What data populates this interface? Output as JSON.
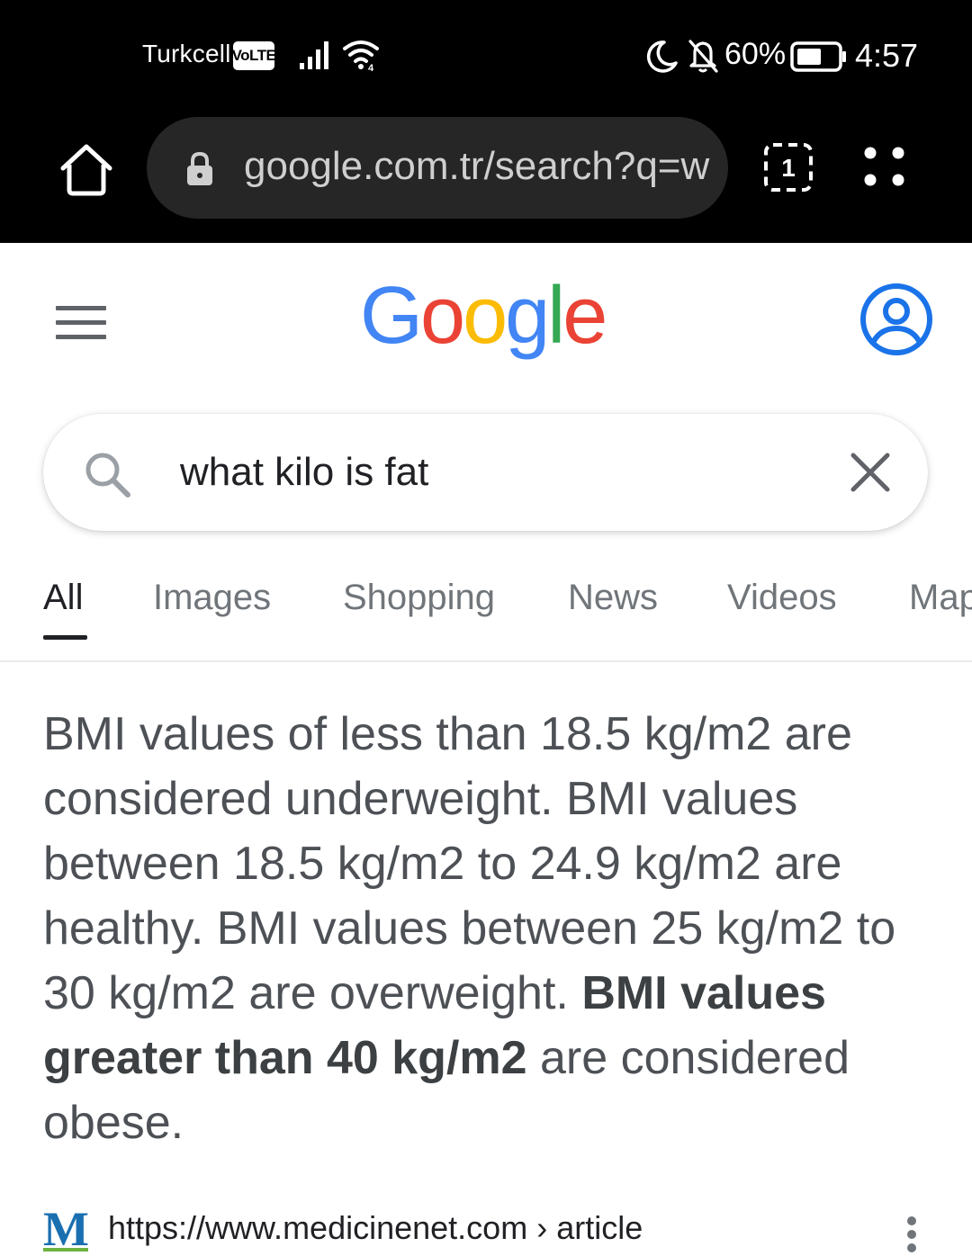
{
  "status_bar": {
    "carrier": "Turkcell",
    "volte_badge": "VoLTE",
    "battery_percent": "60%",
    "time": "4:57",
    "icons": [
      "signal-icon",
      "wifi-icon",
      "moon-icon",
      "bell-off-icon",
      "battery-icon"
    ]
  },
  "browser": {
    "url": "google.com.tr/search?q=what+kilo+is+fat",
    "tab_count": "1",
    "icons": [
      "home-icon",
      "lock-icon",
      "tabs-icon",
      "menu-dots-icon"
    ]
  },
  "google": {
    "logo_letters": [
      {
        "char": "G",
        "color": "#4285F4"
      },
      {
        "char": "o",
        "color": "#EA4335"
      },
      {
        "char": "o",
        "color": "#FBBC05"
      },
      {
        "char": "g",
        "color": "#4285F4"
      },
      {
        "char": "l",
        "color": "#34A853"
      },
      {
        "char": "e",
        "color": "#EA4335"
      }
    ],
    "account_color": "#1a73e8"
  },
  "search": {
    "query": "what kilo is fat"
  },
  "tabs": [
    {
      "label": "All",
      "active": true
    },
    {
      "label": "Images",
      "active": false
    },
    {
      "label": "Shopping",
      "active": false
    },
    {
      "label": "News",
      "active": false
    },
    {
      "label": "Videos",
      "active": false
    },
    {
      "label": "Maps",
      "active": false
    }
  ],
  "snippet": {
    "text_before": "BMI values of less than 18.5 kg/m2 are considered underweight. BMI values between 18.5 kg/m2 to 24.9 kg/m2 are healthy. BMI values between 25 kg/m2 to 30 kg/m2 are overweight. ",
    "text_bold": "BMI values greater than 40 kg/m2",
    "text_after": " are considered obese."
  },
  "source": {
    "favicon_letter": "M",
    "url": "https://www.medicinenet.com",
    "breadcrumb": " › article"
  }
}
